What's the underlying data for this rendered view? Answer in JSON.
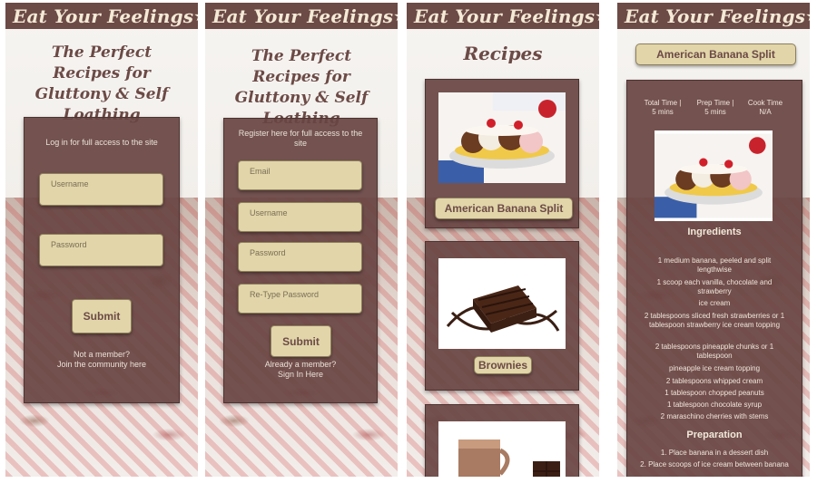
{
  "brand": "Eat Your Feelings",
  "login": {
    "heading": "The Perfect Recipes for Gluttony & Self Loathing",
    "note": "Log in for full access to the site",
    "username_placeholder": "Username",
    "password_placeholder": "Password",
    "submit": "Submit",
    "footer1": "Not a member?",
    "footer2": "Join the community here"
  },
  "register": {
    "heading": "The Perfect Recipes for Gluttony & Self Loathing",
    "note": "Register here for full access to the site",
    "email_placeholder": "Email",
    "username_placeholder": "Username",
    "password_placeholder": "Password",
    "retype_placeholder": "Re-Type Password",
    "submit": "Submit",
    "footer1": "Already a member?",
    "footer2": "Sign In Here"
  },
  "recipes": {
    "heading": "Recipes",
    "items": [
      {
        "label": "American Banana Split",
        "image": "banana-split-photo"
      },
      {
        "label": "Brownies",
        "image": "brownies-photo"
      },
      {
        "label": "",
        "image": "hot-chocolate-photo"
      }
    ]
  },
  "detail": {
    "title": "American Banana Split",
    "total_time_label": "Total Time |",
    "total_time": "5 mins",
    "prep_time_label": "Prep Time |",
    "prep_time": "5 mins",
    "cook_time_label": "Cook Time",
    "cook_time": "N/A",
    "ingredients_heading": "Ingredients",
    "ingredients": [
      "1 medium banana, peeled  and split lengthwise",
      "1 scoop each vanilla, chocolate and strawberry",
      "ice cream",
      "2 tablespoons sliced fresh strawberries or 1 tablespoon strawberry ice cream topping",
      "2 tablespoons pineapple chunks or 1 tablespoon",
      "pineapple ice cream topping",
      "2 tablespoons whipped cream",
      "1 tablespoon chopped peanuts",
      "1 tablespoon chocolate syrup",
      "2 maraschino cherries with stems"
    ],
    "preparation_heading": "Preparation",
    "steps": [
      "1. Place banana in a dessert dish",
      "2. Place scoops of ice cream between banana"
    ]
  },
  "colors": {
    "header": "#6c4a46",
    "card": "#684442",
    "button": "#e1d5a9",
    "brand_text": "#f4ead6"
  }
}
